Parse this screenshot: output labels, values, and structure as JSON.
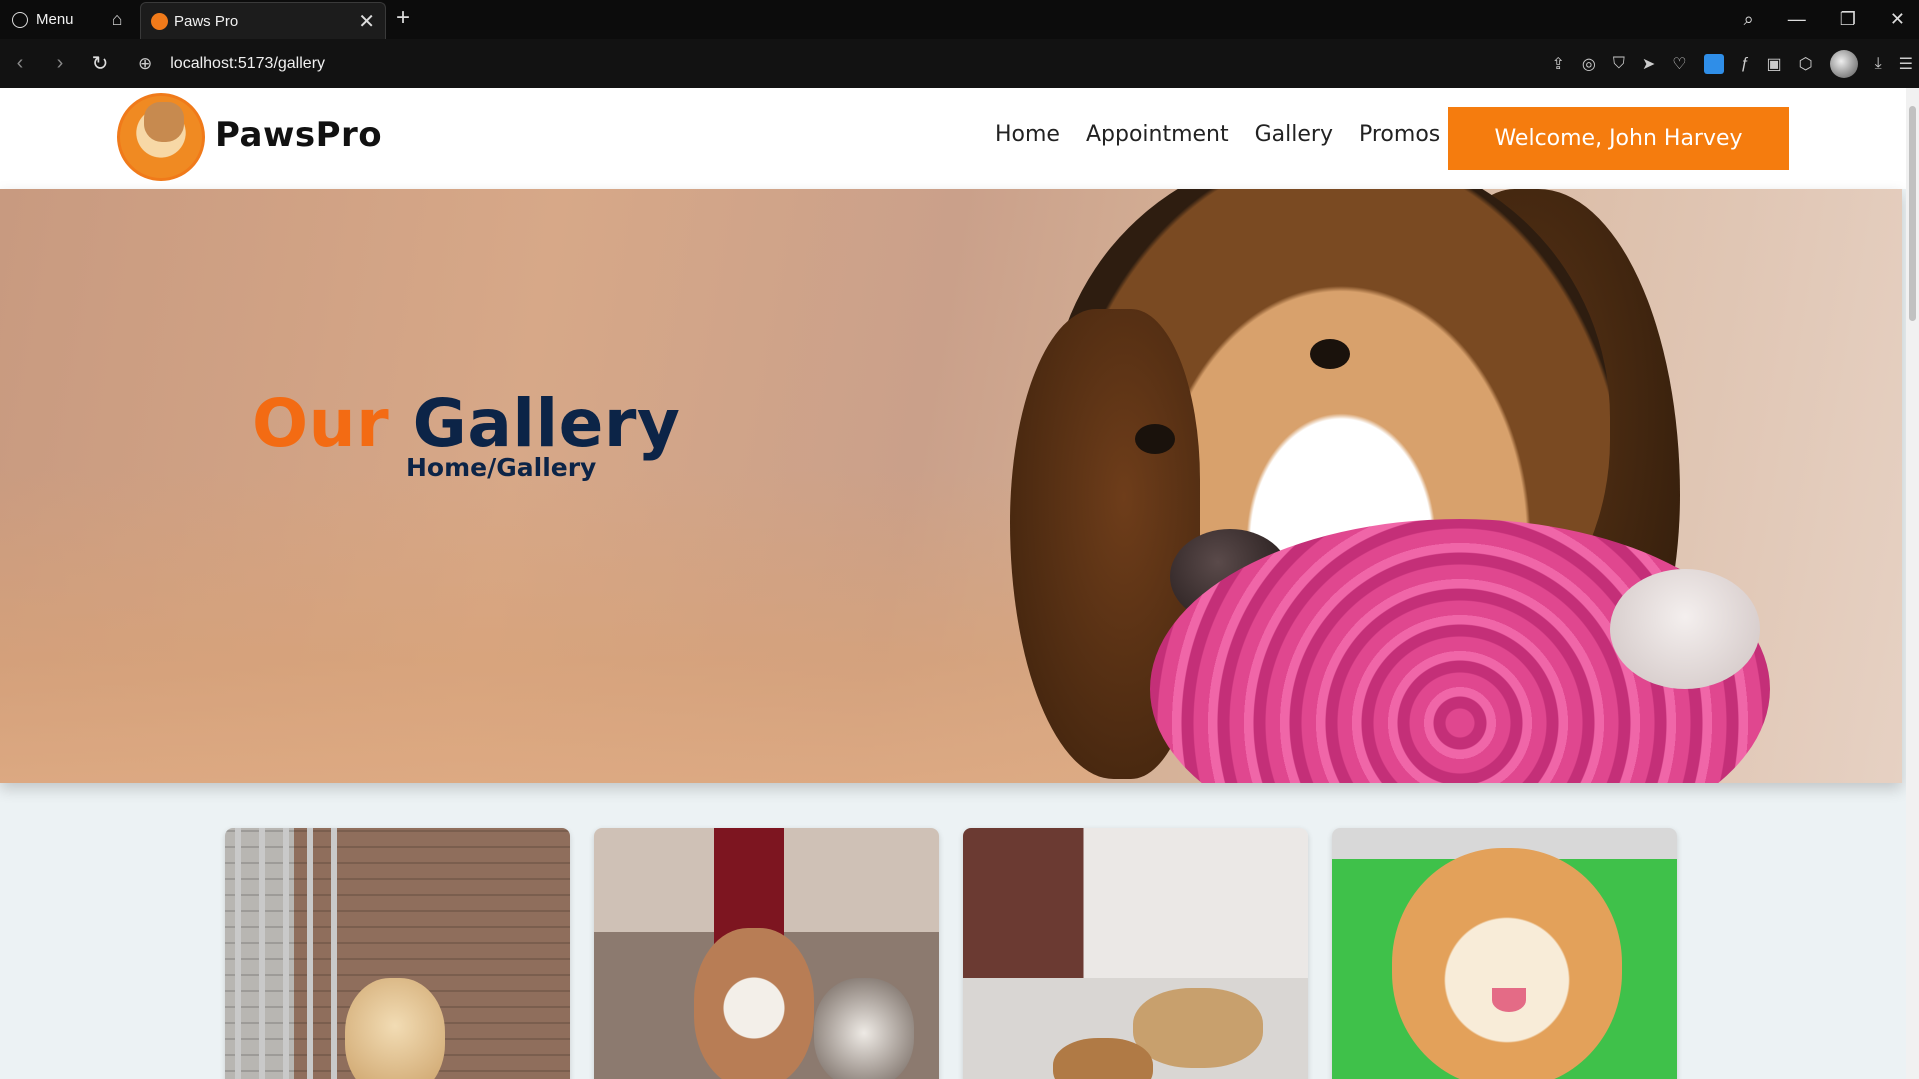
{
  "browser": {
    "menu_label": "Menu",
    "tab_title": "Paws Pro",
    "url": "localhost:5173/gallery"
  },
  "header": {
    "brand": "PawsPro",
    "nav": [
      "Home",
      "Appointment",
      "Gallery",
      "Promos"
    ],
    "welcome": "Welcome, John Harvey"
  },
  "hero": {
    "title_accent": "Our",
    "title_main": "Gallery",
    "breadcrumb": "Home/Gallery"
  },
  "colors": {
    "accent": "#f57c0e",
    "title_orange": "#f36b13",
    "navy": "#0c2447"
  },
  "gallery": {
    "images": [
      "golden-retriever-photo",
      "husky-and-shih-tzu-photo",
      "dogs-on-floor-photo",
      "pomeranian-photo"
    ]
  }
}
